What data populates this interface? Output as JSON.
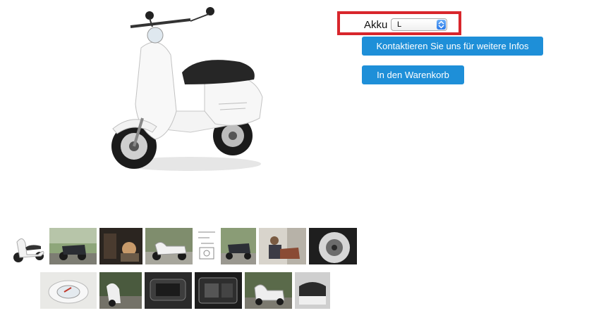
{
  "product": {
    "main_image_alt": "white-scooter-image"
  },
  "options": {
    "label": "Akku",
    "selected_value": "L"
  },
  "buttons": {
    "contact_label": "Kontaktieren Sie uns für weitere Infos",
    "cart_label": "In den Warenkorb"
  },
  "colors": {
    "button_blue": "#1e8fd8",
    "highlight_red": "#d8262c"
  }
}
